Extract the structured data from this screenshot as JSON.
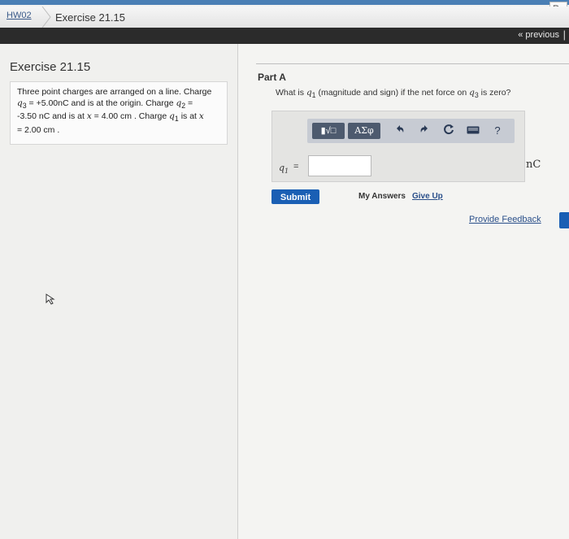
{
  "top_right_button": "Re",
  "breadcrumb": {
    "assignment": "HW02",
    "exercise": "Exercise 21.15"
  },
  "nav": {
    "previous": "« previous",
    "pipe": "|"
  },
  "left": {
    "heading": "Exercise 21.15",
    "problem": {
      "p1": "Three point charges are arranged on a line. Charge",
      "q3_sym": "q",
      "q3_sub": "3",
      "p2": " = +5.00nC and is at the origin. Charge ",
      "q2_sym": "q",
      "q2_sub": "2",
      "p3": " =",
      "p4": "-3.50 nC and is at ",
      "x1": "x",
      "p5": " = 4.00 cm . Charge ",
      "q1_sym": "q",
      "q1_sub": "1",
      "p6": " is at ",
      "x2": "x",
      "p7": "= 2.00 cm ."
    }
  },
  "part": {
    "title": "Part A",
    "q_a": "What is ",
    "q_b": "q",
    "q_b_sub": "1",
    "q_c": " (magnitude and sign) if the net force on ",
    "q_d": "q",
    "q_d_sub": "3",
    "q_e": " is zero?"
  },
  "toolbar": {
    "templates": "▮√□",
    "greek": "ΑΣφ",
    "undo_icon": "undo-icon",
    "redo_icon": "redo-icon",
    "reset_icon": "reset-icon",
    "keyboard_icon": "keyboard-icon",
    "help": "?"
  },
  "answer": {
    "label_sym": "q",
    "label_sub": "1",
    "eq": "=",
    "value": "",
    "unit": "nC"
  },
  "actions": {
    "submit": "Submit",
    "my_answers": "My Answers",
    "give_up": "Give Up",
    "feedback": "Provide Feedback"
  },
  "colors": {
    "submit": "#1a5fb4",
    "toolbar": "#c7cbd3",
    "nav": "#2b2b2b"
  }
}
